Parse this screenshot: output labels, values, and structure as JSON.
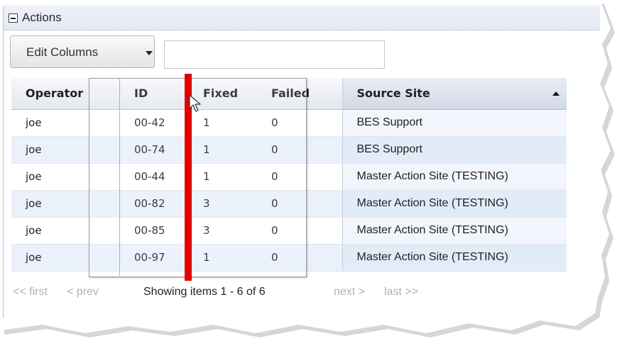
{
  "panel": {
    "title": "Actions",
    "collapse_icon": "minus-box-icon"
  },
  "toolbar": {
    "edit_columns_label": "Edit Columns",
    "edit_columns_caret_icon": "caret-down-icon",
    "filter_value": "",
    "filter_placeholder": ""
  },
  "table": {
    "columns": [
      "Operator",
      "ID",
      "Fixed",
      "Failed",
      "Source Site"
    ],
    "sorted_column": "Source Site",
    "sort_direction": "ascending",
    "sort_icon": "sort-up-icon",
    "rows": [
      {
        "operator": "joe",
        "id": "00-42",
        "fixed": "1",
        "failed": "0",
        "source_site": "BES Support"
      },
      {
        "operator": "joe",
        "id": "00-74",
        "fixed": "1",
        "failed": "0",
        "source_site": "BES Support"
      },
      {
        "operator": "joe",
        "id": "00-44",
        "fixed": "1",
        "failed": "0",
        "source_site": "Master Action Site (TESTING)"
      },
      {
        "operator": "joe",
        "id": "00-82",
        "fixed": "3",
        "failed": "0",
        "source_site": "Master Action Site (TESTING)"
      },
      {
        "operator": "joe",
        "id": "00-85",
        "fixed": "3",
        "failed": "0",
        "source_site": "Master Action Site (TESTING)"
      },
      {
        "operator": "joe",
        "id": "00-97",
        "fixed": "1",
        "failed": "0",
        "source_site": "Master Action Site (TESTING)"
      }
    ]
  },
  "pager": {
    "first": "<< first",
    "prev": "< prev",
    "status": "Showing items 1 - 6 of 6",
    "next": "next >",
    "last": "last >>"
  },
  "overlay": {
    "cursor_icon": "mouse-pointer-icon",
    "marker_color": "#e30000"
  }
}
